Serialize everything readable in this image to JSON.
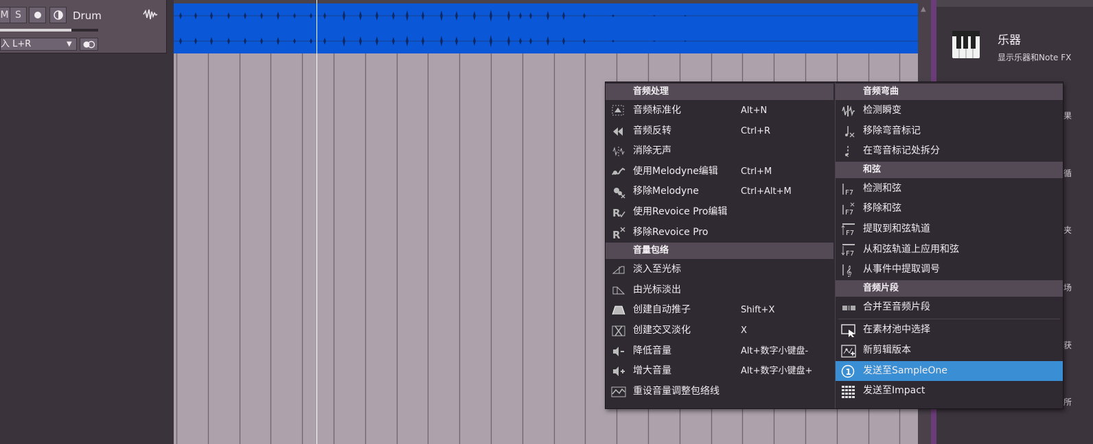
{
  "track": {
    "buttons": [
      "M",
      "S"
    ],
    "name": "Drum",
    "volume_fraction": 0.73,
    "input_label": "入 L+R"
  },
  "browser": {
    "instruments_title": "乐器",
    "instruments_subtitle": "显示乐器和Note FX",
    "partial_labels": [
      "果",
      "循",
      "夹",
      "场",
      "获",
      "所"
    ]
  },
  "context_menu": {
    "left": {
      "sections": [
        {
          "title": "音频处理",
          "items": [
            {
              "icon": "normalize-icon",
              "label": "音频标准化",
              "shortcut": "Alt+N"
            },
            {
              "icon": "reverse-icon",
              "label": "音频反转",
              "shortcut": "Ctrl+R"
            },
            {
              "icon": "strip-silence-icon",
              "label": "消除无声",
              "shortcut": ""
            },
            {
              "icon": "melodyne-edit-icon",
              "label": "使用Melodyne编辑",
              "shortcut": "Ctrl+M"
            },
            {
              "icon": "melodyne-remove-icon",
              "label": "移除Melodyne",
              "shortcut": "Ctrl+Alt+M"
            },
            {
              "icon": "revoice-edit-icon",
              "label": "使用Revoice Pro编辑",
              "shortcut": ""
            },
            {
              "icon": "revoice-remove-icon",
              "label": "移除Revoice Pro",
              "shortcut": ""
            }
          ]
        },
        {
          "title": "音量包络",
          "items": [
            {
              "icon": "fade-in-icon",
              "label": "淡入至光标",
              "shortcut": ""
            },
            {
              "icon": "fade-out-icon",
              "label": "由光标淡出",
              "shortcut": ""
            },
            {
              "icon": "auto-fader-icon",
              "label": "创建自动推子",
              "shortcut": "Shift+X"
            },
            {
              "icon": "crossfade-icon",
              "label": "创建交叉淡化",
              "shortcut": "X"
            },
            {
              "icon": "volume-down-icon",
              "label": "降低音量",
              "shortcut": "Alt+数字小键盘-"
            },
            {
              "icon": "volume-up-icon",
              "label": "增大音量",
              "shortcut": "Alt+数字小键盘+"
            },
            {
              "icon": "reset-envelope-icon",
              "label": " 重设音量调整包络线",
              "shortcut": ""
            }
          ]
        }
      ]
    },
    "right": {
      "sections": [
        {
          "title": "音频弯曲",
          "items": [
            {
              "icon": "detect-transients-icon",
              "label": "检测瞬变"
            },
            {
              "icon": "remove-bend-markers-icon",
              "label": "移除弯音标记"
            },
            {
              "icon": "split-at-bend-icon",
              "label": "在弯音标记处拆分"
            }
          ]
        },
        {
          "title": "和弦",
          "items": [
            {
              "icon": "detect-chords-icon",
              "label": "检测和弦"
            },
            {
              "icon": "remove-chords-icon",
              "label": "移除和弦"
            },
            {
              "icon": "extract-chord-track-icon",
              "label": "提取到和弦轨道"
            },
            {
              "icon": "apply-chord-track-icon",
              "label": "从和弦轨道上应用和弦"
            },
            {
              "icon": "extract-key-icon",
              "label": "从事件中提取调号"
            }
          ]
        },
        {
          "title": "音频片段",
          "items": [
            {
              "icon": "merge-clip-icon",
              "label": "合并至音频片段"
            }
          ]
        }
      ],
      "extra_items": [
        {
          "icon": "select-in-pool-icon",
          "label": "在素材池中选择",
          "highlighted": false
        },
        {
          "icon": "new-version-icon",
          "label": "新剪辑版本",
          "highlighted": false
        },
        {
          "icon": "sampleone-icon",
          "label": "发送至SampleOne",
          "highlighted": true
        },
        {
          "icon": "impact-icon",
          "label": "发送至Impact",
          "highlighted": false
        }
      ]
    }
  }
}
